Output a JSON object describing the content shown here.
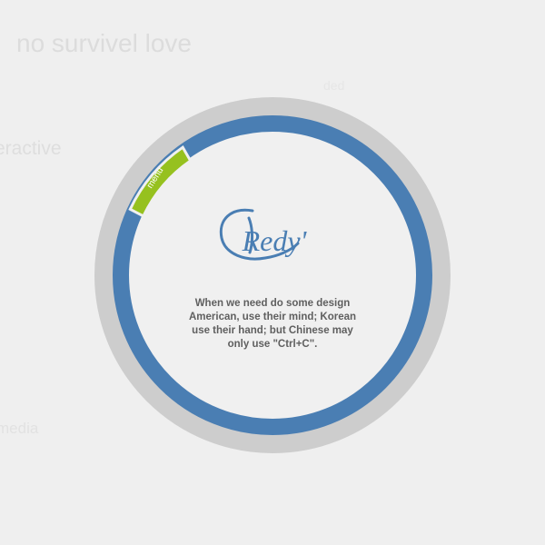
{
  "background": {
    "title": "no survivel love",
    "words": {
      "interactive": "eractive",
      "better": "better",
      "ded": "ded",
      "media": "media"
    }
  },
  "menu": {
    "label": "menu"
  },
  "logo": {
    "text": "Redy'"
  },
  "description": "When we need do some design American, use their mind; Korean use their hand; but Chinese may only use \"Ctrl+C\".",
  "colors": {
    "background": "#efefef",
    "outer_ring": "#cdcdcd",
    "inner_ring": "#4a7eb3",
    "menu_accent": "#96c11f",
    "text": "#5f5f5f"
  },
  "icons": {
    "logo": "redy-signature-logo"
  }
}
